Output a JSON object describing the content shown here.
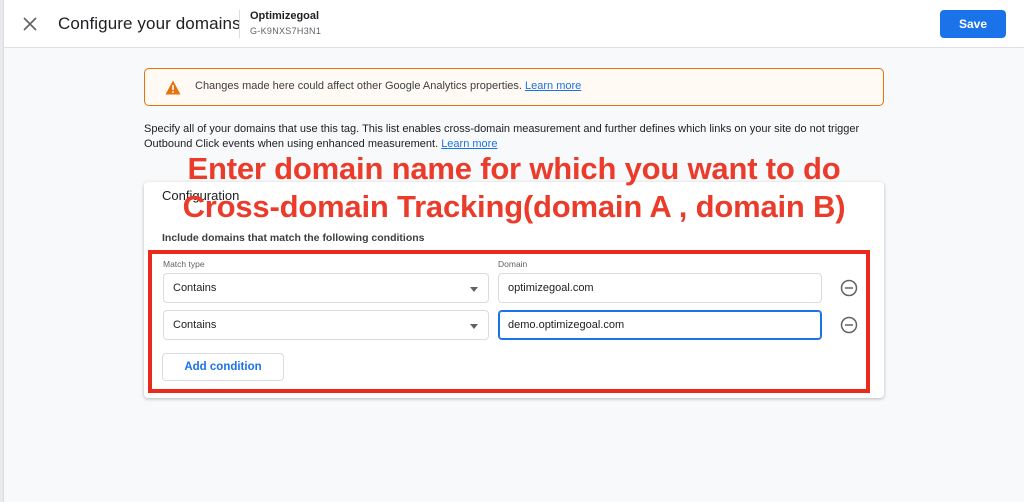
{
  "header": {
    "title": "Configure your domains",
    "property_name": "Optimizegoal",
    "property_id": "G-K9NXS7H3N1",
    "save_label": "Save"
  },
  "warning": {
    "text": "Changes made here could affect other Google Analytics properties.",
    "link": "Learn more"
  },
  "description": {
    "text": "Specify all of your domains that use this tag. This list enables cross-domain measurement and further defines which links on your site do not trigger Outbound Click events when using enhanced measurement.",
    "link": "Learn more"
  },
  "configuration": {
    "title": "Configuration",
    "subtitle": "Include domains that match the following conditions",
    "match_type_label": "Match type",
    "domain_label": "Domain",
    "conditions": [
      {
        "match_type": "Contains",
        "domain": "optimizegoal.com"
      },
      {
        "match_type": "Contains",
        "domain": "demo.optimizegoal.com"
      }
    ],
    "add_condition_label": "Add condition"
  },
  "annotation": {
    "line1": "Enter domain name for which you want to do",
    "line2": "Cross-domain Tracking(domain A , domain B)"
  },
  "colors": {
    "primary": "#1a73e8",
    "warning": "#e8710a",
    "annotation": "#ea2a1b"
  }
}
